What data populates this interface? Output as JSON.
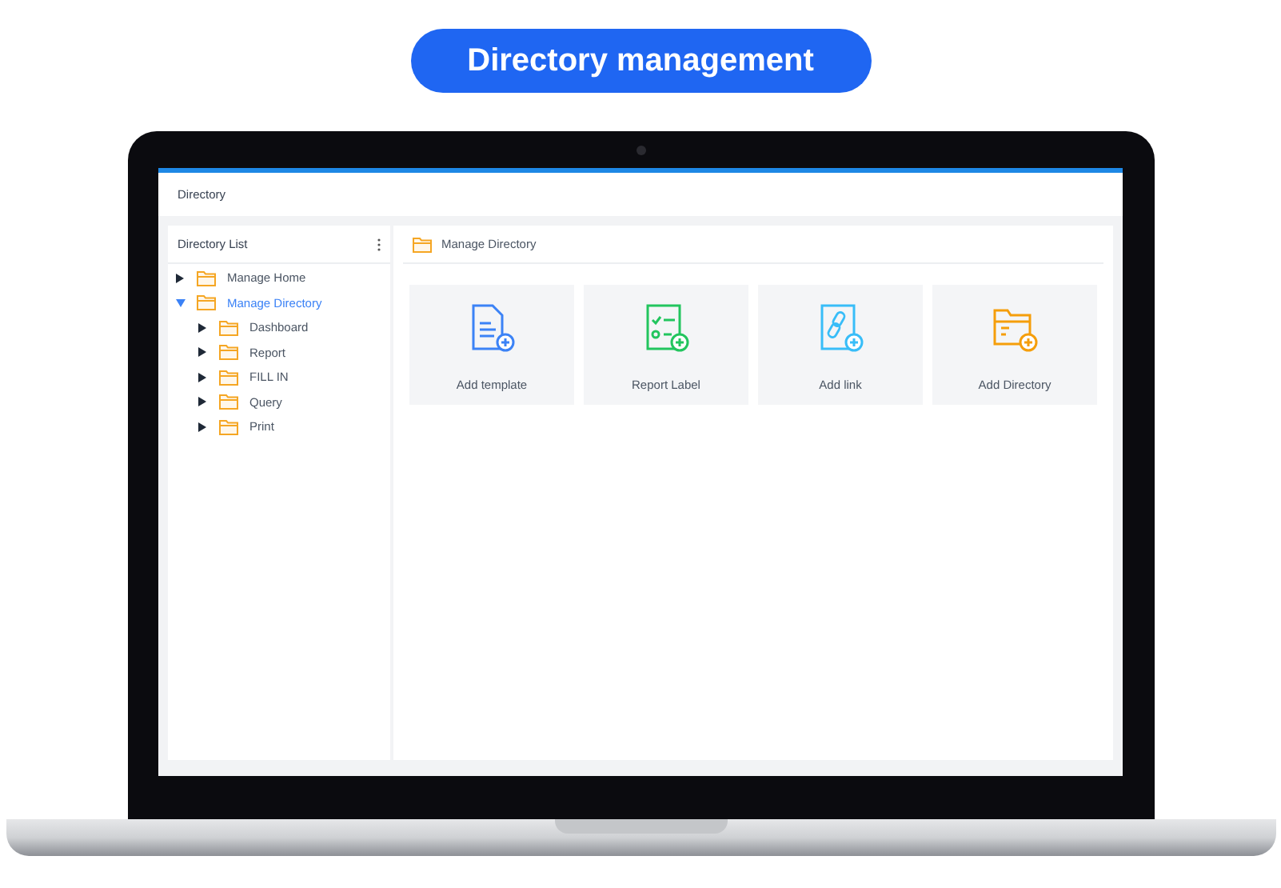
{
  "banner": {
    "title": "Directory management"
  },
  "window": {
    "title": "Directory"
  },
  "sidebar": {
    "title": "Directory List",
    "tree": [
      {
        "label": "Manage Home",
        "selected": false,
        "expanded": false
      },
      {
        "label": "Manage Directory",
        "selected": true,
        "expanded": true,
        "children": [
          {
            "label": "Dashboard",
            "selected": false,
            "expanded": false
          },
          {
            "label": "Report",
            "selected": false,
            "expanded": false
          },
          {
            "label": "FILL IN",
            "selected": false,
            "expanded": false
          },
          {
            "label": "Query",
            "selected": false,
            "expanded": false
          },
          {
            "label": "Print",
            "selected": false,
            "expanded": false
          }
        ]
      }
    ]
  },
  "main": {
    "breadcrumb": "Manage Directory",
    "cards": [
      {
        "label": "Add template",
        "kind": "template"
      },
      {
        "label": "Report Label",
        "kind": "label"
      },
      {
        "label": "Add link",
        "kind": "link"
      },
      {
        "label": "Add Directory",
        "kind": "directory"
      }
    ]
  }
}
